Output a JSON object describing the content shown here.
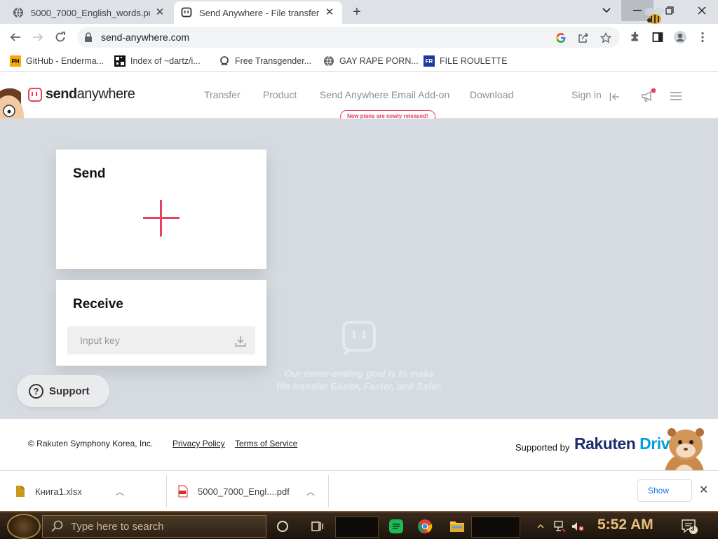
{
  "browser": {
    "tabs": [
      {
        "title": "5000_7000_English_words.pdf",
        "active": false
      },
      {
        "title": "Send Anywhere - File transfer",
        "active": true
      }
    ],
    "url": "send-anywhere.com",
    "bookmarks": [
      {
        "label": "GitHub - Enderma...",
        "icon": "ph-icon"
      },
      {
        "label": "Index of ~dartz/i...",
        "icon": "index-icon"
      },
      {
        "label": "Free Transgender...",
        "icon": "bookmark-site-icon"
      },
      {
        "label": "GAY RAPE PORN...",
        "icon": "globe-icon"
      },
      {
        "label": "FILE ROULETTE",
        "icon": "file-roulette-icon"
      }
    ]
  },
  "site": {
    "logo_prefix": "send",
    "logo_suffix": "anywhere",
    "nav": [
      "Transfer",
      "Product",
      "Send Anywhere Email Add-on",
      "Download"
    ],
    "promo_badge": "New plans are newly released!",
    "sign_in": "Sign in",
    "brand_color": "#e8425f"
  },
  "send_card": {
    "title": "Send"
  },
  "receive_card": {
    "title": "Receive",
    "input_placeholder": "Input key"
  },
  "tagline": {
    "line1": "Our never-ending goal is to make",
    "line2": "file transfer Easier, Faster, and Safer."
  },
  "support": {
    "label": "Support"
  },
  "footer": {
    "copyright": "© Rakuten Symphony Korea, Inc.",
    "privacy": "Privacy Policy",
    "terms": "Terms of Service",
    "supported_by": "Supported by",
    "sponsor_main": "Rakuten",
    "sponsor_sub": "Driv"
  },
  "downloads": [
    {
      "name": "Книга1.xlsx",
      "icon": "xlsx-file-icon"
    },
    {
      "name": "5000_7000_Engl....pdf",
      "icon": "pdf-file-icon"
    }
  ],
  "download_shelf": {
    "show_all": "Show"
  },
  "taskbar": {
    "search_placeholder": "Type here to search",
    "time": "5:52 AM",
    "notification_count": "3"
  }
}
